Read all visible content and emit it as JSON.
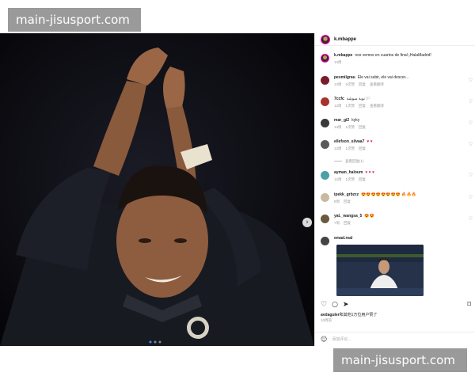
{
  "watermark": {
    "top": "main-jisusport.com",
    "bottom": "main-jisusport.com"
  },
  "post": {
    "username": "k.mbappe",
    "caption_user": "k.mbappe",
    "caption_text": "nos vemos en cuartos de final ¡HalaMadrid!",
    "caption_time": "13周"
  },
  "comments": [
    {
      "user": "pesmilgrau",
      "text": "Ele vai subir, ele vai descer...",
      "time": "13周",
      "likes": "5次赞",
      "reply": "回复",
      "translate": "查看翻译"
    },
    {
      "user": "7ccfc",
      "text": "نوبة سوشة 🏳️",
      "time": "13周",
      "likes": "1次赞",
      "reply": "回复",
      "translate": "查看翻译"
    },
    {
      "user": "mar_gi2",
      "text": "kyky",
      "time": "13周",
      "likes": "1次赞",
      "reply": "回复"
    },
    {
      "user": "ellefson_silvaa7",
      "text": "♥ ♥",
      "time": "13周",
      "likes": "1次赞",
      "reply": "回复"
    },
    {
      "user": "ayman_haloum",
      "text": "♥ ♥ ♥",
      "time": "12周",
      "likes": "1次赞",
      "reply": "回复"
    },
    {
      "user": "ipekk_grbzzz",
      "text": "😍😍😍😍😍😍😍😍 🔥🔥🔥",
      "time": "8周",
      "likes": "",
      "reply": "回复"
    },
    {
      "user": "yat._wangsa_5",
      "text": "😍😍",
      "time": "7周",
      "likes": "",
      "reply": "回复"
    },
    {
      "user": "emad.real",
      "text": "",
      "time": "",
      "likes": "",
      "reply": ""
    }
  ],
  "more_replies": "查看回复(1)",
  "likes_line": {
    "user": "avdaguler",
    "text": "和其他1万位用户赞了"
  },
  "date": "10周前",
  "add_comment_placeholder": "添加评论..."
}
